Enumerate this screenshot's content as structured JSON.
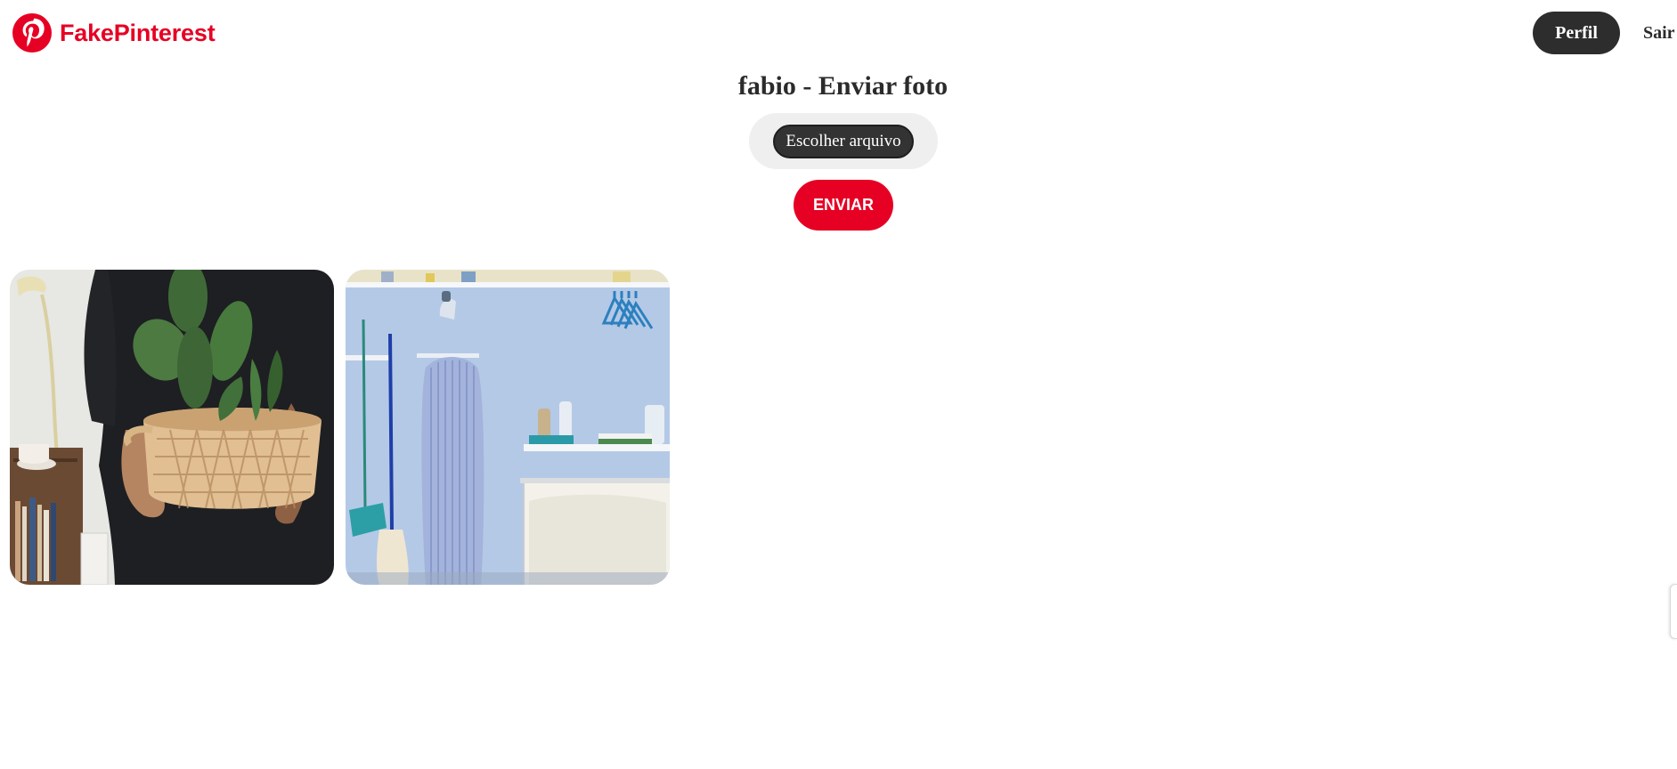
{
  "brand": {
    "name": "FakePinterest",
    "color": "#e60023",
    "icon": "pinterest-logo-icon"
  },
  "nav": {
    "perfil_label": "Perfil",
    "sair_label": "Sair"
  },
  "upload": {
    "title": "fabio - Enviar foto",
    "file_button_label": "Escolher arquivo",
    "submit_label": "ENVIAR"
  },
  "photos": [
    {
      "subject": "person holding woven basket with cactus"
    },
    {
      "subject": "laundry room wall with ironing board and mop"
    }
  ],
  "colors": {
    "accent": "#e60023",
    "dark_button": "#2d2d2d",
    "file_field_bg": "#efefef"
  }
}
